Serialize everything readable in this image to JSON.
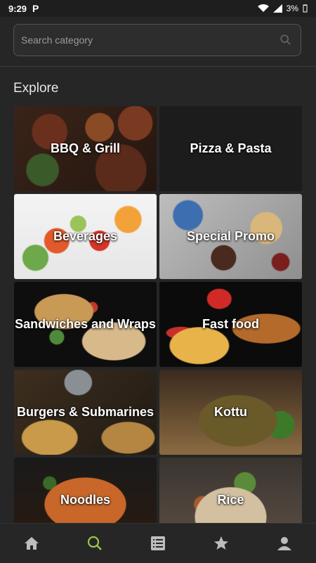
{
  "status_bar": {
    "time": "9:29",
    "app_mark": "P",
    "battery": "3%"
  },
  "search": {
    "placeholder": "Search category"
  },
  "section": {
    "title": "Explore"
  },
  "categories": [
    {
      "label": "BBQ & Grill"
    },
    {
      "label": "Pizza & Pasta"
    },
    {
      "label": "Beverages"
    },
    {
      "label": "Special Promo"
    },
    {
      "label": "Sandwiches and Wraps"
    },
    {
      "label": "Fast food"
    },
    {
      "label": "Burgers & Submarines"
    },
    {
      "label": "Kottu"
    },
    {
      "label": "Noodles"
    },
    {
      "label": "Rice"
    }
  ],
  "nav": {
    "items": [
      "home-icon",
      "search-icon",
      "list-icon",
      "star-icon",
      "profile-icon"
    ],
    "active": "search-icon",
    "active_color": "#9bc54a",
    "inactive_color": "#bdbdbd"
  }
}
